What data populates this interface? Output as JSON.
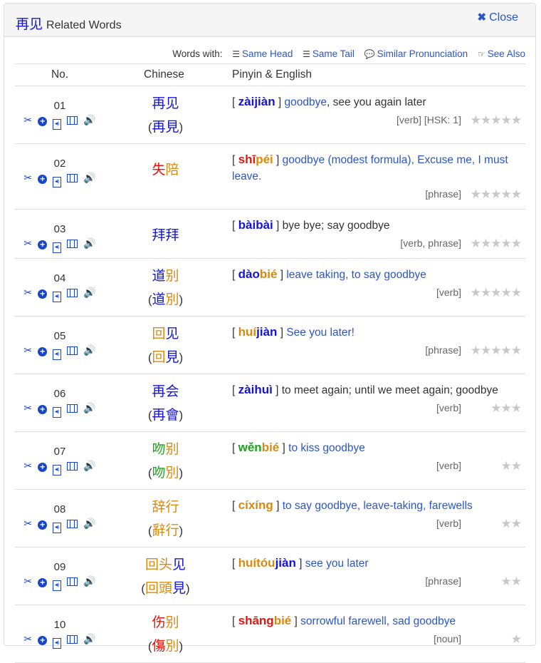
{
  "header": {
    "word": [
      {
        "c": "再",
        "t": "t4"
      },
      {
        "c": "见",
        "t": "t4"
      }
    ],
    "title": "Related Words",
    "close_label": "Close",
    "close_icon": "✖"
  },
  "filters": {
    "label": "Words with:",
    "links": [
      {
        "icon": "align-left-icon",
        "glyph": "☰",
        "label": "Same Head"
      },
      {
        "icon": "align-right-icon",
        "glyph": "☰",
        "label": "Same Tail"
      },
      {
        "icon": "comments-icon",
        "glyph": "💬",
        "label": "Similar Pronunciation"
      },
      {
        "icon": "hand-right-icon",
        "glyph": "☞",
        "label": "See Also"
      }
    ]
  },
  "columns": {
    "no": "No.",
    "chinese": "Chinese",
    "pinyin": "Pinyin & English"
  },
  "row_icons": [
    "scissors-icon",
    "plus-circle-icon",
    "audio-file-icon",
    "film-icon",
    "volume-icon"
  ],
  "rows": [
    {
      "no": "01",
      "simp": [
        {
          "c": "再",
          "t": "t4"
        },
        {
          "c": "见",
          "t": "t4"
        }
      ],
      "trad": [
        {
          "c": "再",
          "t": "t4"
        },
        {
          "c": "見",
          "t": "t4"
        }
      ],
      "pinyin": [
        {
          "s": "zài",
          "t": "t4"
        },
        {
          "s": "jiàn",
          "t": "t4"
        }
      ],
      "def": [
        {
          "s": "goodbye",
          "k": "link"
        },
        {
          "s": ", see you again later",
          "k": "plain"
        }
      ],
      "meta": "[verb] [HSK: 1]",
      "stars": 5
    },
    {
      "no": "02",
      "simp": [
        {
          "c": "失",
          "t": "t1"
        },
        {
          "c": "陪",
          "t": "t2"
        }
      ],
      "trad": null,
      "pinyin": [
        {
          "s": "shī",
          "t": "t1"
        },
        {
          "s": "péi",
          "t": "t2"
        }
      ],
      "def": [
        {
          "s": "goodbye (modest formula), Excuse me, I must leave.",
          "k": "link"
        }
      ],
      "meta": "[phrase]",
      "stars": 5
    },
    {
      "no": "03",
      "simp": [
        {
          "c": "拜",
          "t": "t4"
        },
        {
          "c": "拜",
          "t": "t4"
        }
      ],
      "trad": null,
      "pinyin": [
        {
          "s": "bài",
          "t": "t4"
        },
        {
          "s": "bài",
          "t": "t4"
        }
      ],
      "def": [
        {
          "s": "bye bye; say goodbye",
          "k": "plain"
        }
      ],
      "meta": "[verb, phrase]",
      "stars": 5
    },
    {
      "no": "04",
      "simp": [
        {
          "c": "道",
          "t": "t4"
        },
        {
          "c": "别",
          "t": "t2"
        }
      ],
      "trad": [
        {
          "c": "道",
          "t": "t4"
        },
        {
          "c": "別",
          "t": "t2"
        }
      ],
      "pinyin": [
        {
          "s": "dào",
          "t": "t4"
        },
        {
          "s": "bié",
          "t": "t2"
        }
      ],
      "def": [
        {
          "s": "leave taking, to say goodbye",
          "k": "link"
        }
      ],
      "meta": "[verb]",
      "stars": 5
    },
    {
      "no": "05",
      "simp": [
        {
          "c": "回",
          "t": "t2"
        },
        {
          "c": "见",
          "t": "t4"
        }
      ],
      "trad": [
        {
          "c": "回",
          "t": "t2"
        },
        {
          "c": "見",
          "t": "t4"
        }
      ],
      "pinyin": [
        {
          "s": "huí",
          "t": "t2"
        },
        {
          "s": "jiàn",
          "t": "t4"
        }
      ],
      "def": [
        {
          "s": "See you later!",
          "k": "link"
        }
      ],
      "meta": "[phrase]",
      "stars": 5
    },
    {
      "no": "06",
      "simp": [
        {
          "c": "再",
          "t": "t4"
        },
        {
          "c": "会",
          "t": "t4"
        }
      ],
      "trad": [
        {
          "c": "再",
          "t": "t4"
        },
        {
          "c": "會",
          "t": "t4"
        }
      ],
      "pinyin": [
        {
          "s": "zài",
          "t": "t4"
        },
        {
          "s": "huì",
          "t": "t4"
        }
      ],
      "def": [
        {
          "s": "to meet again; until we meet again; goodbye",
          "k": "plain"
        }
      ],
      "meta": "[verb]",
      "stars": 3
    },
    {
      "no": "07",
      "simp": [
        {
          "c": "吻",
          "t": "t3"
        },
        {
          "c": "别",
          "t": "t2"
        }
      ],
      "trad": [
        {
          "c": "吻",
          "t": "t3"
        },
        {
          "c": "別",
          "t": "t2"
        }
      ],
      "pinyin": [
        {
          "s": "wěn",
          "t": "t3"
        },
        {
          "s": "bié",
          "t": "t2"
        }
      ],
      "def": [
        {
          "s": "to kiss goodbye",
          "k": "link"
        }
      ],
      "meta": "[verb]",
      "stars": 2
    },
    {
      "no": "08",
      "simp": [
        {
          "c": "辞",
          "t": "t2"
        },
        {
          "c": "行",
          "t": "t2"
        }
      ],
      "trad": [
        {
          "c": "辭",
          "t": "t2"
        },
        {
          "c": "行",
          "t": "t2"
        }
      ],
      "pinyin": [
        {
          "s": "cí",
          "t": "t2"
        },
        {
          "s": "xíng",
          "t": "t2"
        }
      ],
      "def": [
        {
          "s": "to say goodbye, leave-taking, farewells",
          "k": "link"
        }
      ],
      "meta": "[verb]",
      "stars": 2
    },
    {
      "no": "09",
      "simp": [
        {
          "c": "回",
          "t": "t2"
        },
        {
          "c": "头",
          "t": "t2"
        },
        {
          "c": "见",
          "t": "t4"
        }
      ],
      "trad": [
        {
          "c": "回",
          "t": "t2"
        },
        {
          "c": "頭",
          "t": "t2"
        },
        {
          "c": "見",
          "t": "t4"
        }
      ],
      "pinyin": [
        {
          "s": "huí",
          "t": "t2"
        },
        {
          "s": "tóu",
          "t": "t2"
        },
        {
          "s": "jiàn",
          "t": "t4"
        }
      ],
      "def": [
        {
          "s": "see you later",
          "k": "link"
        }
      ],
      "meta": "[phrase]",
      "stars": 2
    },
    {
      "no": "10",
      "simp": [
        {
          "c": "伤",
          "t": "t1"
        },
        {
          "c": "别",
          "t": "t2"
        }
      ],
      "trad": [
        {
          "c": "傷",
          "t": "t1"
        },
        {
          "c": "別",
          "t": "t2"
        }
      ],
      "pinyin": [
        {
          "s": "shāng",
          "t": "t1"
        },
        {
          "s": "bié",
          "t": "t2"
        }
      ],
      "def": [
        {
          "s": "sorrowful farewell, sad goodbye",
          "k": "link"
        }
      ],
      "meta": "[noun]",
      "stars": 1
    }
  ]
}
